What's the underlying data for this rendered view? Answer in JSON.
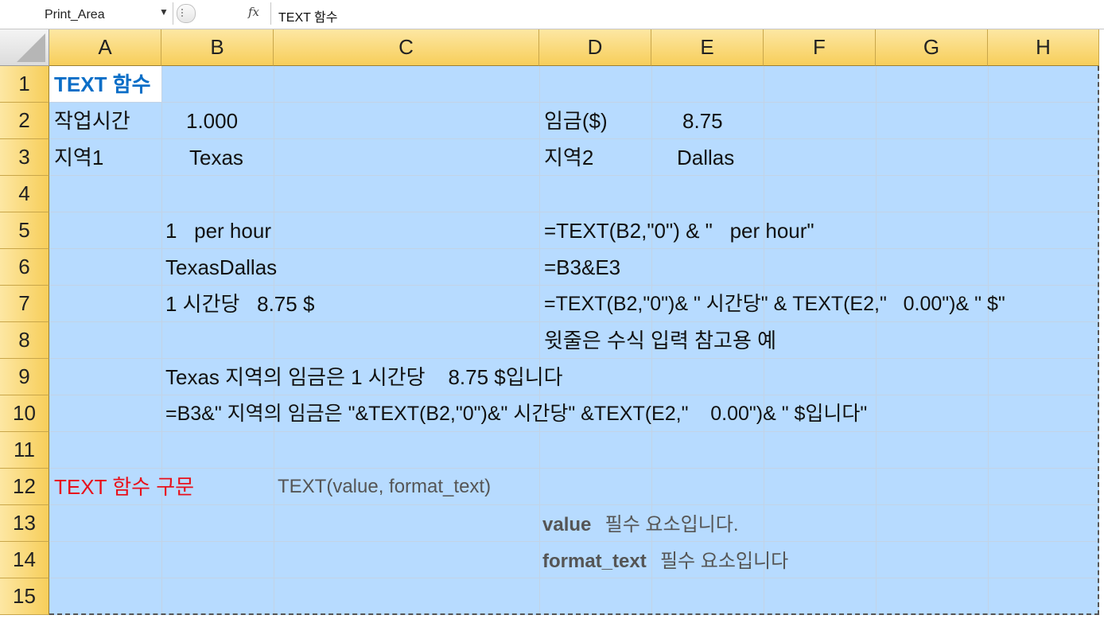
{
  "formula_bar": {
    "name_box": "Print_Area",
    "fx_label": "fx",
    "content": "TEXT 함수"
  },
  "columns": [
    "A",
    "B",
    "C",
    "D",
    "E",
    "F",
    "G",
    "H"
  ],
  "rows": [
    "1",
    "2",
    "3",
    "4",
    "5",
    "6",
    "7",
    "8",
    "9",
    "10",
    "11",
    "12",
    "13",
    "14",
    "15"
  ],
  "cells": {
    "A1": "TEXT 함수",
    "A2": "작업시간",
    "B2": "1.000",
    "D2": "임금($)",
    "E2": "8.75",
    "A3": "지역1",
    "B3": "Texas",
    "D3": "지역2",
    "E3": "Dallas",
    "B5": "1   per hour",
    "D5": "=TEXT(B2,\"0\") & \"   per hour\"",
    "B6": "TexasDallas",
    "D6": "=B3&E3",
    "B7": "1 시간당   8.75 $",
    "D7": "=TEXT(B2,\"0\")& \" 시간당\" & TEXT(E2,\"   0.00\")& \" $\"",
    "D8": "윗줄은 수식 입력 참고용 예",
    "B9": "Texas 지역의 임금은 1 시간당    8.75 $입니다",
    "B10": "=B3&\" 지역의 임금은 \"&TEXT(B2,\"0\")&\" 시간당\" &TEXT(E2,\"    0.00\")& \" $입니다\"",
    "A12": "TEXT 함수 구문",
    "C12": "TEXT(value, format_text)",
    "D13_bold": "value",
    "D13_rest": "필수 요소입니다.",
    "D14_bold": "format_text",
    "D14_rest": "필수 요소입니다"
  },
  "colors": {
    "sheet_fill": "#b7dbff",
    "header_fill": "#f7ce5a",
    "title_blue": "#0a6ec7",
    "red": "#e8101b"
  }
}
